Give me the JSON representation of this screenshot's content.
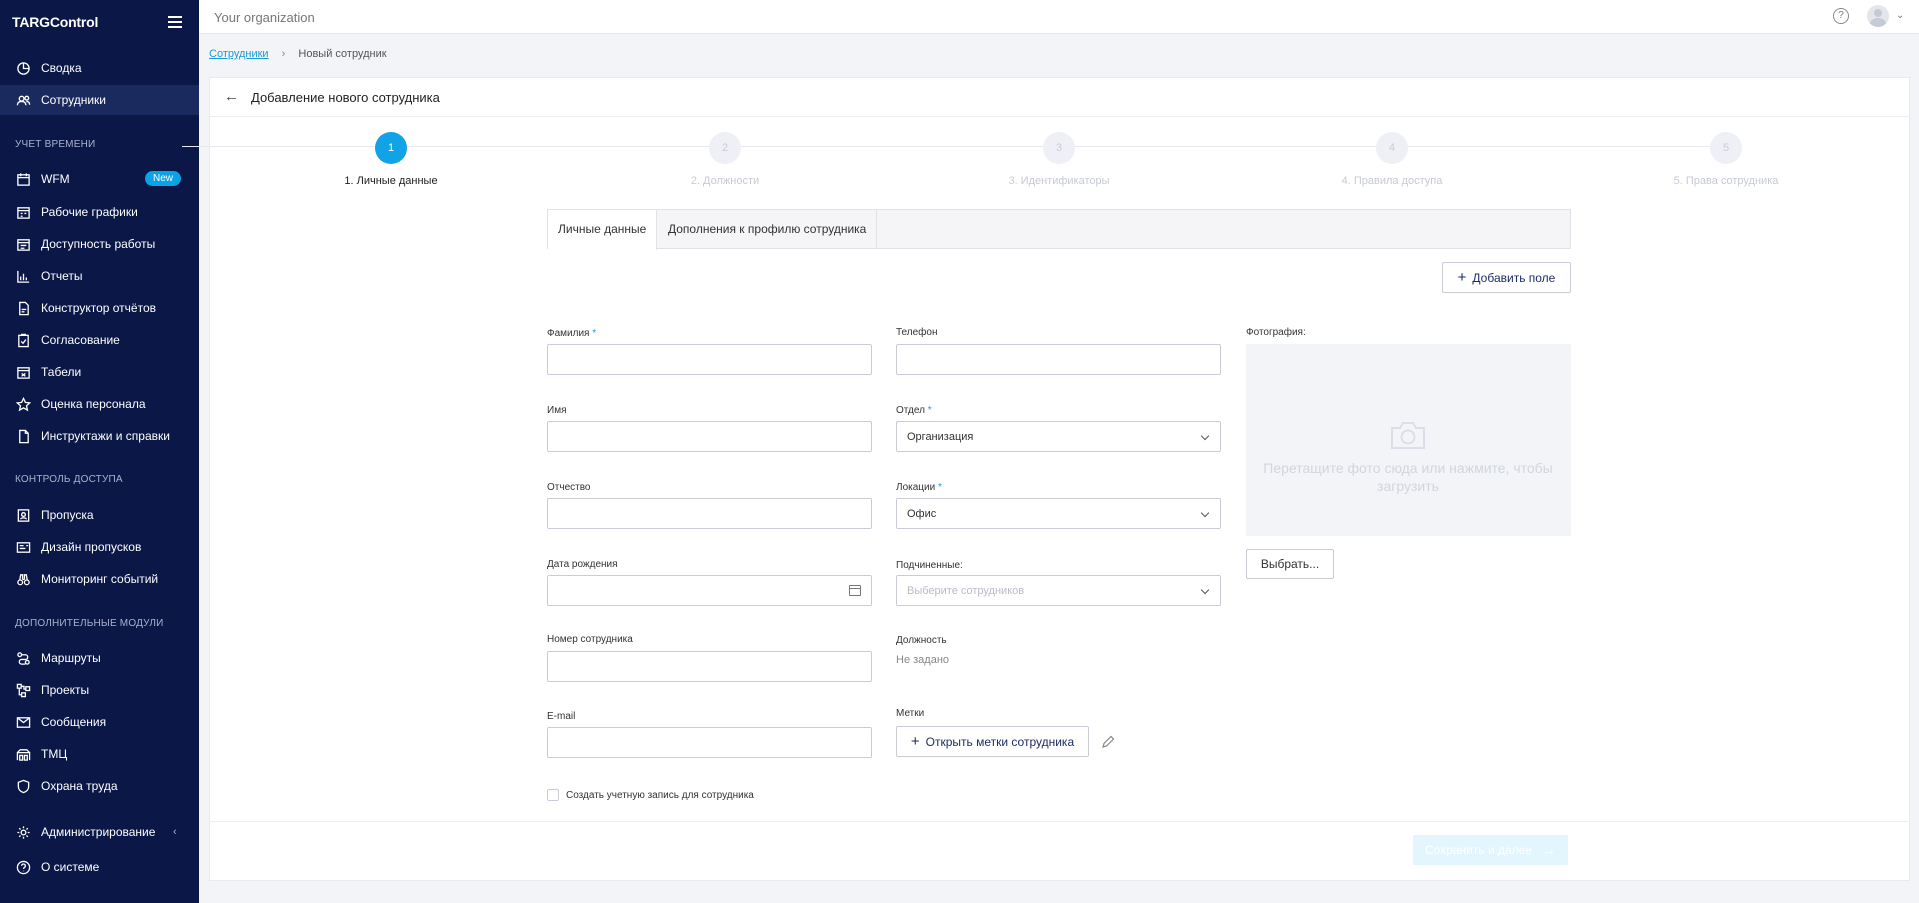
{
  "sidebar": {
    "brand": "TARGControl",
    "items_top": [
      {
        "label": "Сводка",
        "icon": "chart-pie-icon"
      },
      {
        "label": "Сотрудники",
        "icon": "users-icon"
      }
    ],
    "section_time": "Учет времени",
    "items_time": [
      {
        "label": "WFM",
        "icon": "calendar-icon",
        "badge": "New"
      },
      {
        "label": "Рабочие графики",
        "icon": "schedule-icon"
      },
      {
        "label": "Доступность работы",
        "icon": "availability-icon"
      },
      {
        "label": "Отчеты",
        "icon": "bar-chart-icon"
      },
      {
        "label": "Конструктор отчётов",
        "icon": "report-builder-icon"
      },
      {
        "label": "Согласование",
        "icon": "clipboard-check-icon"
      },
      {
        "label": "Табели",
        "icon": "timesheet-icon"
      },
      {
        "label": "Оценка персонала",
        "icon": "star-icon"
      },
      {
        "label": "Инструктажи и справки",
        "icon": "document-icon"
      }
    ],
    "section_access": "Контроль доступа",
    "items_access": [
      {
        "label": "Пропуска",
        "icon": "badge-icon"
      },
      {
        "label": "Дизайн пропусков",
        "icon": "pass-design-icon"
      },
      {
        "label": "Мониторинг событий",
        "icon": "binoculars-icon"
      }
    ],
    "section_modules": "Дополнительные модули",
    "items_modules": [
      {
        "label": "Маршруты",
        "icon": "route-icon"
      },
      {
        "label": "Проекты",
        "icon": "projects-icon"
      },
      {
        "label": "Сообщения",
        "icon": "mail-icon"
      },
      {
        "label": "ТМЦ",
        "icon": "warehouse-icon"
      },
      {
        "label": "Охрана труда",
        "icon": "shield-icon"
      }
    ],
    "items_bottom": [
      {
        "label": "Администрирование",
        "icon": "gear-icon"
      },
      {
        "label": "О системе",
        "icon": "help-circle-icon"
      }
    ]
  },
  "topbar": {
    "org": "Your organization",
    "help": "?"
  },
  "breadcrumb": {
    "parent": "Сотрудники",
    "current": "Новый сотрудник"
  },
  "page": {
    "title": "Добавление нового сотрудника"
  },
  "steps": [
    {
      "num": "1",
      "label": "1. Личные данные"
    },
    {
      "num": "2",
      "label": "2. Должности"
    },
    {
      "num": "3",
      "label": "3. Идентификаторы"
    },
    {
      "num": "4",
      "label": "4. Правила доступа"
    },
    {
      "num": "5",
      "label": "5. Права сотрудника"
    }
  ],
  "tabs": {
    "personal": "Личные данные",
    "extra": "Дополнения к профилю сотрудника"
  },
  "add_field": "Добавить поле",
  "form": {
    "last_name": {
      "label": "Фамилия",
      "value": ""
    },
    "first_name": {
      "label": "Имя",
      "value": ""
    },
    "middle_name": {
      "label": "Отчество",
      "value": ""
    },
    "birth_date": {
      "label": "Дата рождения",
      "value": ""
    },
    "employee_number": {
      "label": "Номер сотрудника",
      "value": ""
    },
    "email": {
      "label": "E-mail",
      "value": ""
    },
    "phone": {
      "label": "Телефон",
      "value": ""
    },
    "department": {
      "label": "Отдел",
      "value": "Организация"
    },
    "location": {
      "label": "Локации",
      "value": "Офис"
    },
    "subordinates": {
      "label": "Подчиненные:",
      "placeholder": "Выберите сотрудников"
    },
    "position": {
      "label": "Должность",
      "value": "Не задано"
    },
    "tags": {
      "label": "Метки",
      "button": "Открыть метки сотрудника"
    },
    "photo": {
      "label": "Фотография:",
      "hint": "Перетащите фото сюда или нажмите, чтобы загрузить",
      "choose": "Выбрать..."
    },
    "required_mark": "*",
    "create_account": "Создать учетную запись для сотрудника"
  },
  "footer": {
    "save_next": "Сохранить и далее"
  },
  "colors": {
    "sidebar_bg": "#0b1747",
    "accent": "#11a3e6",
    "badge": "#0aa3e8"
  }
}
